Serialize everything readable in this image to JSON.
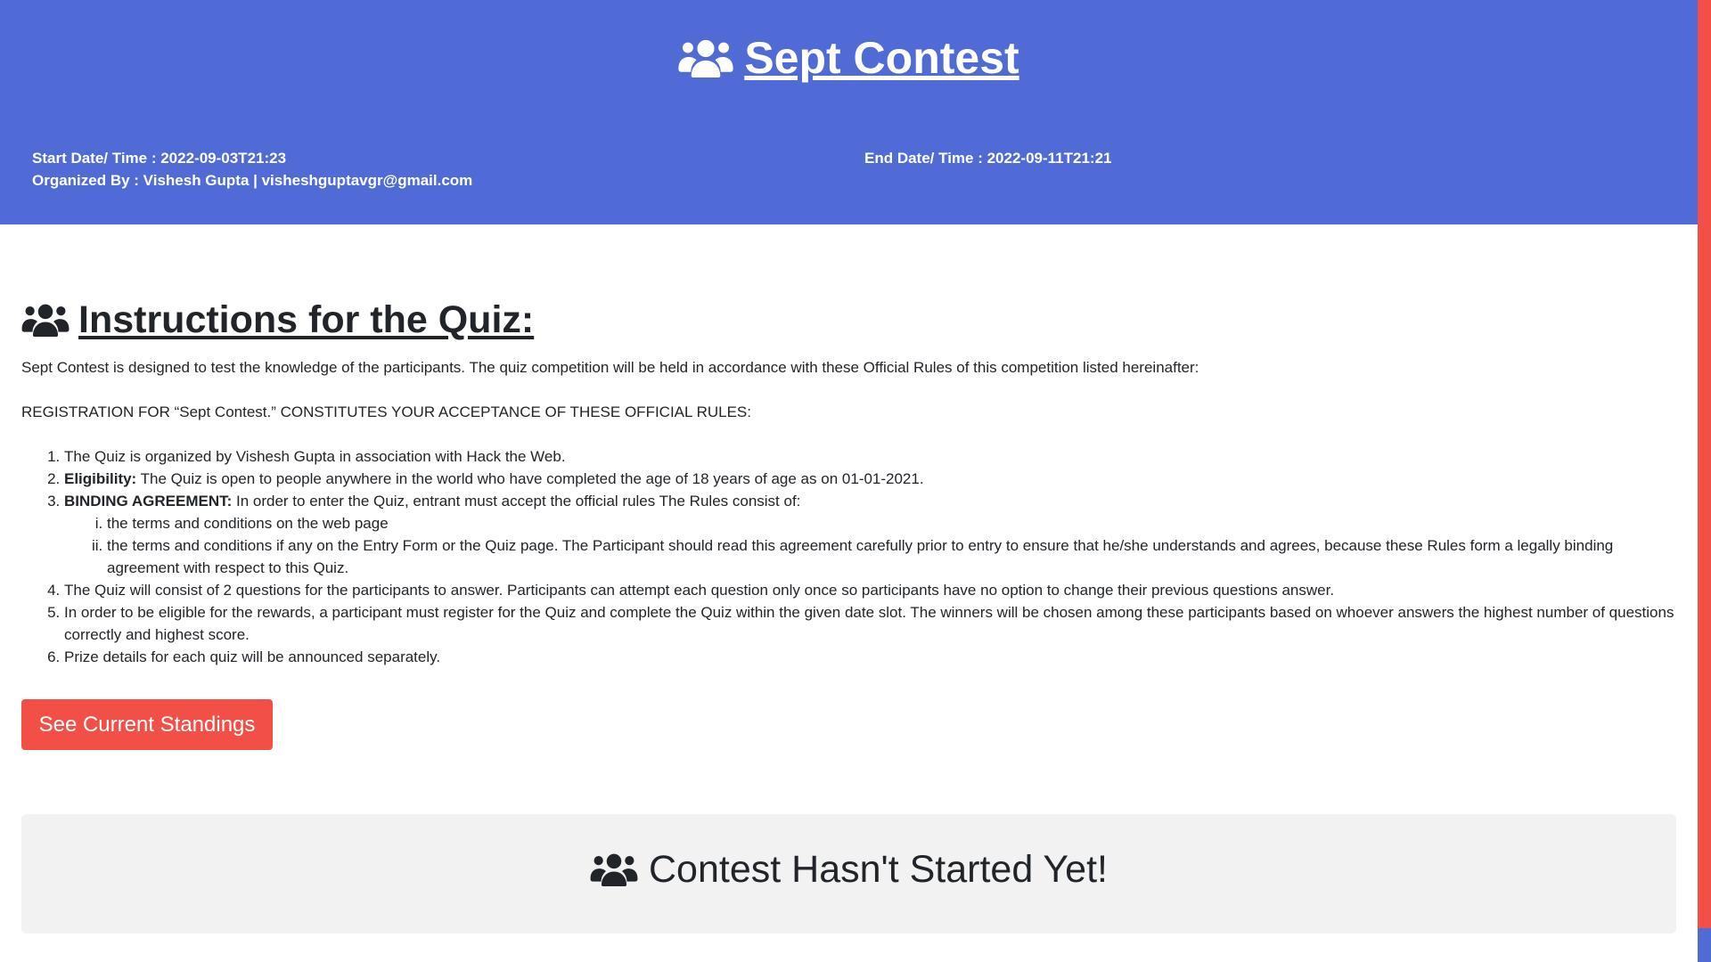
{
  "header": {
    "title": "Sept Contest",
    "start_label": "Start Date/ Time : 2022-09-03T21:23",
    "end_label": "End Date/ Time : 2022-09-11T21:21",
    "organized_label": "Organized By : Vishesh Gupta | visheshguptavgr@gmail.com",
    "icon": "users-icon"
  },
  "instructions": {
    "heading": "Instructions for the Quiz:",
    "intro": "Sept Contest is designed to test the knowledge of the participants. The quiz competition will be held in accordance with these Official Rules of this competition listed hereinafter:",
    "acceptance": "REGISTRATION FOR “Sept Contest.” CONSTITUTES YOUR ACCEPTANCE OF THESE OFFICIAL RULES:",
    "rules": {
      "r1": "The Quiz is organized by Vishesh Gupta in association with Hack the Web.",
      "r2_bold": "Eligibility:",
      "r2_text": " The Quiz is open to people anywhere in the world who have completed the age of 18 years of age as on 01-01-2021.",
      "r3_bold": "BINDING AGREEMENT:",
      "r3_text": " In order to enter the Quiz, entrant must accept the official rules The Rules consist of:",
      "r3_sub1": "the terms and conditions on the web page",
      "r3_sub2": "the terms and conditions if any on the Entry Form or the Quiz page. The Participant should read this agreement carefully prior to entry to ensure that he/she understands and agrees, because these Rules form a legally binding agreement with respect to this Quiz.",
      "r4": "The Quiz will consist of 2 questions for the participants to answer. Participants can attempt each question only once so participants have no option to change their previous questions answer.",
      "r5": "In order to be eligible for the rewards, a participant must register for the Quiz and complete the Quiz within the given date slot. The winners will be chosen among these participants based on whoever answers the highest number of questions correctly and highest score.",
      "r6": "Prize details for each quiz will be announced separately."
    }
  },
  "standings_button": "See Current Standings",
  "status": {
    "message": "Contest Hasn't Started Yet!"
  },
  "colors": {
    "header_bg": "#506bd6",
    "button_bg": "#f25047",
    "status_bg": "#f2f2f2"
  }
}
